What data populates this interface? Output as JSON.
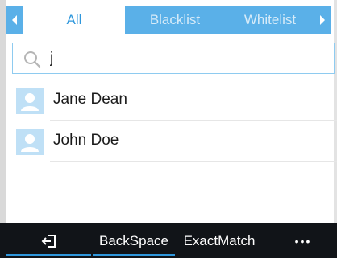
{
  "tabs": [
    {
      "label": "All",
      "active": true
    },
    {
      "label": "Blacklist",
      "active": false
    },
    {
      "label": "Whitelist",
      "active": false
    }
  ],
  "search": {
    "value": "j",
    "icon": "search-icon"
  },
  "contacts": [
    {
      "name": "Jane Dean"
    },
    {
      "name": "John Doe"
    }
  ],
  "bottom_bar": {
    "exit_icon": "exit-icon",
    "backspace_label": "BackSpace",
    "exact_match_label": "ExactMatch",
    "more_label": "•••"
  },
  "colors": {
    "accent": "#2f97dc",
    "tabbar_bg": "#5ab0e8",
    "bottom_bg": "#111418",
    "avatar_bg": "#bfe0f6"
  }
}
